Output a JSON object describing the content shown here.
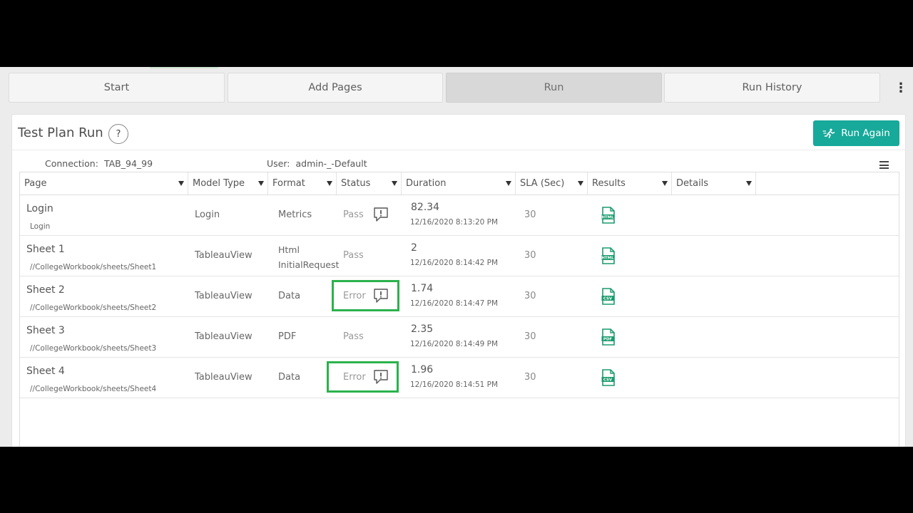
{
  "tabs": [
    {
      "label": "Start",
      "active": false
    },
    {
      "label": "Add Pages",
      "active": false
    },
    {
      "label": "Run",
      "active": true
    },
    {
      "label": "Run History",
      "active": false
    }
  ],
  "more_menu_glyph": "⋮",
  "panel": {
    "title": "Test Plan Run",
    "help_glyph": "?",
    "run_again_label": "Run Again",
    "connection_label": "Connection:",
    "connection_value": "TAB_94_99",
    "user_label": "User:",
    "user_value": "admin-_-Default"
  },
  "columns": [
    "Page",
    "Model Type",
    "Format",
    "Status",
    "Duration",
    "SLA (Sec)",
    "Results",
    "Details"
  ],
  "rows": [
    {
      "page": "Login",
      "path": "Login",
      "model_type": "Login",
      "format": [
        "Metrics"
      ],
      "status": "Pass",
      "status_icon": true,
      "highlight": false,
      "duration": "82.34",
      "timestamp": "12/16/2020 8:13:20 PM",
      "sla": "30",
      "result_icon": "html-file-icon",
      "result_tag": "HTML"
    },
    {
      "page": "Sheet 1",
      "path": "//CollegeWorkbook/sheets/Sheet1",
      "model_type": "TableauView",
      "format": [
        "Html",
        "InitialRequest"
      ],
      "status": "Pass",
      "status_icon": false,
      "highlight": false,
      "duration": "2",
      "timestamp": "12/16/2020 8:14:42 PM",
      "sla": "30",
      "result_icon": "html-file-icon",
      "result_tag": "HTML"
    },
    {
      "page": "Sheet 2",
      "path": "//CollegeWorkbook/sheets/Sheet2",
      "model_type": "TableauView",
      "format": [
        "Data"
      ],
      "status": "Error",
      "status_icon": true,
      "highlight": true,
      "duration": "1.74",
      "timestamp": "12/16/2020 8:14:47 PM",
      "sla": "30",
      "result_icon": "csv-file-icon",
      "result_tag": "CSV"
    },
    {
      "page": "Sheet 3",
      "path": "//CollegeWorkbook/sheets/Sheet3",
      "model_type": "TableauView",
      "format": [
        "PDF"
      ],
      "status": "Pass",
      "status_icon": false,
      "highlight": false,
      "duration": "2.35",
      "timestamp": "12/16/2020 8:14:49 PM",
      "sla": "30",
      "result_icon": "pdf-file-icon",
      "result_tag": "PDF"
    },
    {
      "page": "Sheet 4",
      "path": "//CollegeWorkbook/sheets/Sheet4",
      "model_type": "TableauView",
      "format": [
        "Data"
      ],
      "status": "Error",
      "status_icon": true,
      "highlight": true,
      "duration": "1.96",
      "timestamp": "12/16/2020 8:14:51 PM",
      "sla": "30",
      "result_icon": "csv-file-icon",
      "result_tag": "CSV"
    }
  ],
  "colors": {
    "accent": "#17a99a",
    "highlight": "#2bb24c",
    "file_icon": "#1a9b6e"
  }
}
